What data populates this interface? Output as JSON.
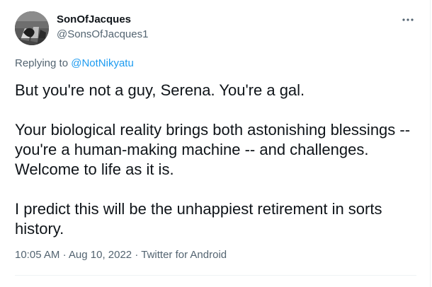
{
  "tweet": {
    "author": {
      "display_name": "SonOfJacques",
      "handle": "@SonsOfJacques1"
    },
    "more_icon": "more-dots-icon",
    "replying_prefix": "Replying to",
    "replying_to": "@NotNikyatu",
    "paragraphs": [
      "But you're not a guy, Serena.  You're a gal.",
      "Your biological reality brings both astonishing blessings -- you're a human-making machine -- and challenges. Welcome to life as it is.",
      "I predict this will be the unhappiest retirement in sorts history."
    ],
    "time": "10:05 AM",
    "separator_1": "·",
    "date": "Aug 10, 2022",
    "separator_2": "·",
    "source": "Twitter for Android"
  },
  "colors": {
    "text": "#0f1419",
    "secondary": "#536471",
    "link": "#1d9bf0",
    "divider": "#eff3f4"
  }
}
